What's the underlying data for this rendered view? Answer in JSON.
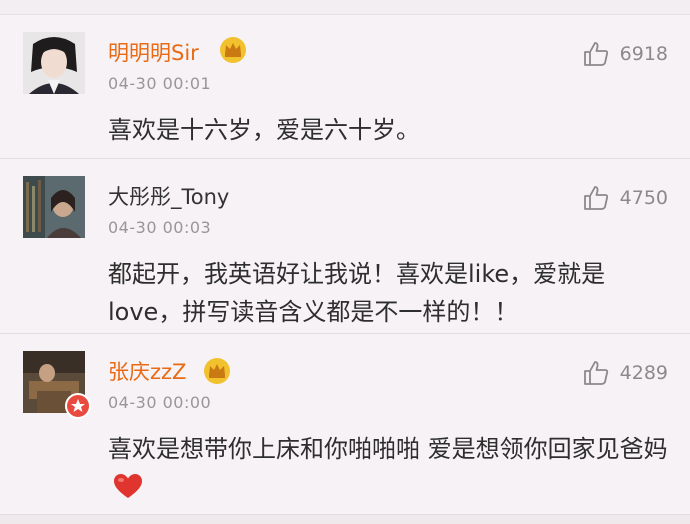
{
  "comments": [
    {
      "user": "明明明Sir",
      "time": "04-30 00:01",
      "likes": "6918",
      "text": "喜欢是十六岁，爱是六十岁。"
    },
    {
      "user": "大彤彤_Tony",
      "time": "04-30 00:03",
      "likes": "4750",
      "text": "都起开，我英语好让我说！喜欢是like，爱就是love，拼写读音含义都是不一样的！！"
    },
    {
      "user": "张庆zzZ",
      "time": "04-30 00:00",
      "likes": "4289",
      "text": "喜欢是想带你上床和你啪啪啪 爱是想领你回家见爸妈"
    }
  ],
  "colors": {
    "vip_name": "#e86a14",
    "normal_name": "#333333",
    "crown": "#e3a21a",
    "heart": "#e0342f"
  },
  "icons": {
    "like": "thumb-up-icon",
    "vip": "crown-icon",
    "heart": "heart-emoji-icon"
  }
}
